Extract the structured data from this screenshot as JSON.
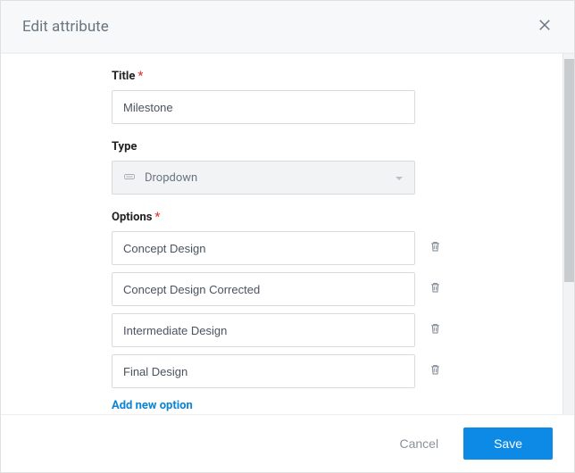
{
  "dialog": {
    "title": "Edit attribute"
  },
  "fields": {
    "title": {
      "label": "Title",
      "value": "Milestone"
    },
    "type": {
      "label": "Type",
      "selected": "Dropdown"
    },
    "options": {
      "label": "Options",
      "items": [
        "Concept Design",
        "Concept Design Corrected",
        "Intermediate Design",
        "Final Design"
      ],
      "add_label": "Add new option"
    }
  },
  "footer": {
    "cancel": "Cancel",
    "save": "Save"
  }
}
